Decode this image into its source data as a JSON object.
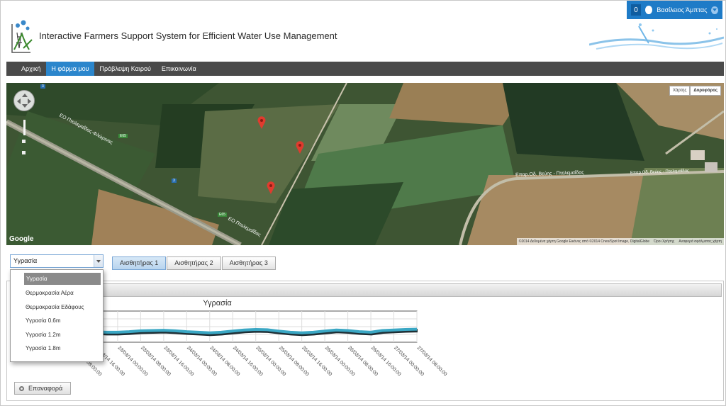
{
  "user": {
    "notification_count": "0",
    "name": "Βασίλειος Άμπτας"
  },
  "header": {
    "title": "Interactive Farmers Support System for Efficient Water Use Management"
  },
  "nav": {
    "items": [
      "Αρχική",
      "Η φάρμα μου",
      "Πρόβλεψη Καιρού",
      "Επικοινωνία"
    ],
    "active": "Η φάρμα μου"
  },
  "map": {
    "type_buttons": [
      "Χάρτης",
      "Δορυφόρος"
    ],
    "road_labels": [
      "ΕΟ Πτολεμαΐδας-Φλώρινας",
      "ΕΟ Πτολεμαΐδας",
      "Επαρ.Οδ. Βεύης - Πτολεμαΐδας",
      "Επαρ.Οδ. Βεύης - Πτολεμαΐδας"
    ],
    "road_numbers": [
      "3",
      "E65",
      "3",
      "E65"
    ],
    "attribution": "©2014 Δεδομένα χάρτη Google Εικόνες από ©2014 Cnes/Spot Image, DigitalGlobe",
    "terms": "Όροι Χρήσης",
    "report": "Αναφορά σφάλματος χάρτη",
    "brand": "Google",
    "pins": 3
  },
  "controls": {
    "metric_selected": "Υγρασία",
    "metric_options": [
      "Υγρασία",
      "Θερμοκρασία Αέρα",
      "Θερμοκρασία Εδάφους",
      "Υγρασία 0.6m",
      "Υγρασία 1.2m",
      "Υγρασία 1.8m"
    ],
    "sensor_tabs": [
      "Αισθητήρας 1",
      "Αισθητήρας 2",
      "Αισθητήρας 3"
    ],
    "active_sensor": "Αισθητήρας 1",
    "reset_label": "Επαναφορά"
  },
  "chart_data": {
    "type": "line",
    "title": "Υγρασία",
    "x_tick_labels": [
      "22/03/14 08:00:00",
      "22/03/14 16:00:00",
      "23/03/14 00:00:00",
      "23/03/14 08:00:00",
      "23/03/14 16:00:00",
      "24/03/14 00:00:00",
      "24/03/14 08:00:00",
      "24/03/14 16:00:00",
      "25/03/14 00:00:00",
      "25/03/14 08:00:00",
      "25/03/14 16:00:00",
      "26/03/14 00:00:00",
      "26/03/14 08:00:00",
      "26/03/14 16:00:00",
      "27/03/14 00:00:00",
      "27/03/14 08:00:00"
    ],
    "x_visible_tick_labels": [
      "23/03/14 00:00:00",
      "23/03/14 08:00:00",
      "23/03/14 16:00:00",
      "24/03/14 00:00:00",
      "24/03/14 08:00:00",
      "24/03/14 16:00:00",
      "25/03/14 00:00:00",
      "25/03/14 08:00:00",
      "25/03/14 16:00:00",
      "26/03/14 00:00:00",
      "26/03/14 08:00:00",
      "26/03/14 16:00:00",
      "27/03/14 00:00:00",
      "27/03/14 08:00:00"
    ],
    "y_axis_labels_visible": false,
    "y_range": [
      0,
      100
    ],
    "grid": true,
    "series": [
      {
        "color": "#3aa7c4",
        "x": [
          0,
          0.5,
          1,
          1.5,
          2,
          2.5,
          3,
          3.5,
          4,
          4.5,
          5,
          5.5,
          6,
          6.5,
          7,
          7.5,
          8,
          8.5,
          9,
          9.5,
          10,
          10.5,
          11,
          11.5,
          12,
          12.5,
          13,
          13.5,
          14,
          14.5,
          15
        ],
        "values": [
          38,
          36,
          32,
          30,
          30,
          32,
          35,
          36,
          37,
          35,
          32,
          30,
          28,
          30,
          34,
          38,
          40,
          39,
          34,
          30,
          28,
          30,
          34,
          38,
          36,
          32,
          30,
          36,
          38,
          40,
          41
        ]
      }
    ]
  }
}
